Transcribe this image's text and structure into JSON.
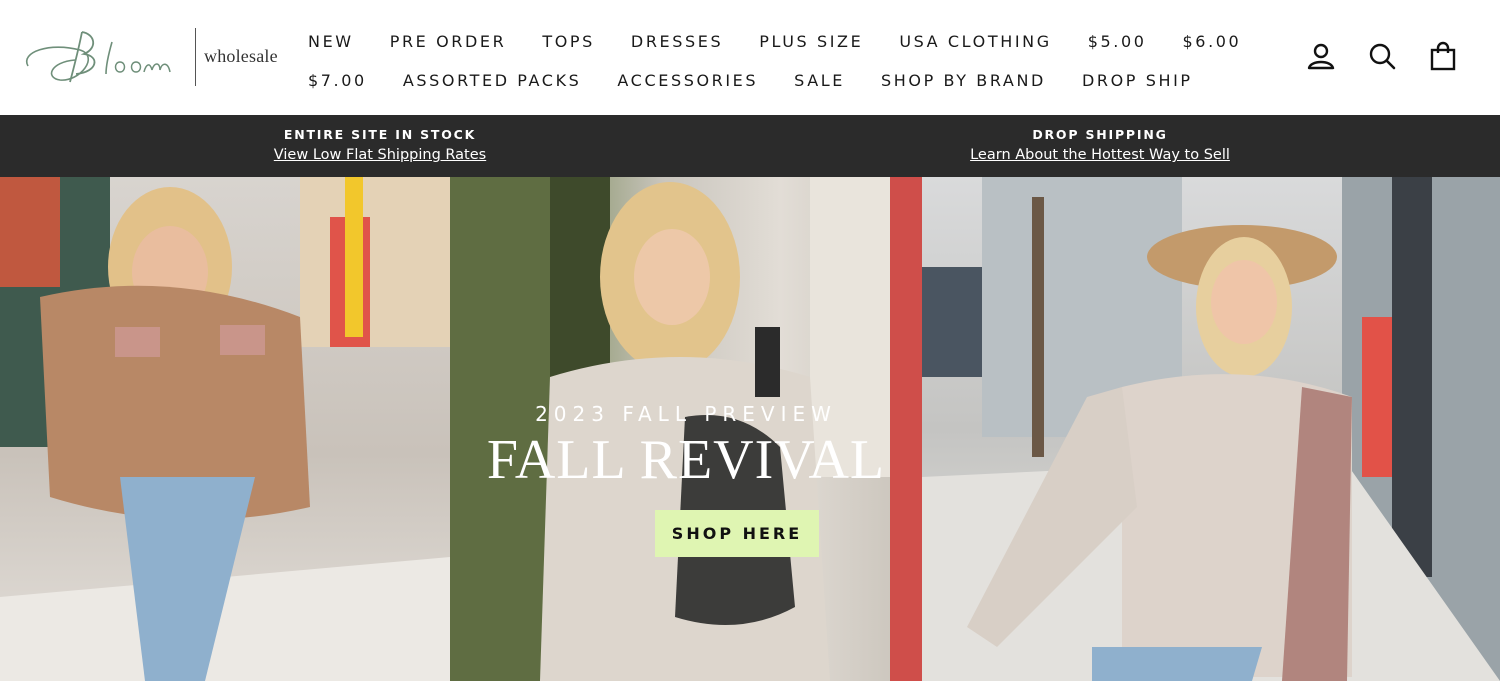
{
  "brand": {
    "logo_word": "wholesale",
    "logo_script": "Bloom"
  },
  "nav": {
    "row1": [
      "NEW",
      "PRE ORDER",
      "TOPS",
      "DRESSES",
      "PLUS SIZE",
      "USA CLOTHING",
      "$5.00",
      "$6.00"
    ],
    "row2": [
      "$7.00",
      "ASSORTED PACKS",
      "ACCESSORIES",
      "SALE",
      "SHOP BY BRAND",
      "DROP SHIP"
    ]
  },
  "header_icons": [
    "account-icon",
    "search-icon",
    "cart-icon"
  ],
  "announcements": {
    "left": {
      "title": "ENTIRE SITE IN STOCK",
      "link": "View Low Flat Shipping Rates"
    },
    "right": {
      "title": "DROP SHIPPING",
      "link": "Learn About the Hottest Way to Sell"
    }
  },
  "hero": {
    "kicker": "2023 FALL PREVIEW",
    "title": "FALL REVIVAL",
    "button": "SHOP HERE",
    "button_color": "#dff5b2"
  },
  "colors": {
    "announcement_bg": "#2b2b2b",
    "logo_green": "#6f8f7a"
  }
}
